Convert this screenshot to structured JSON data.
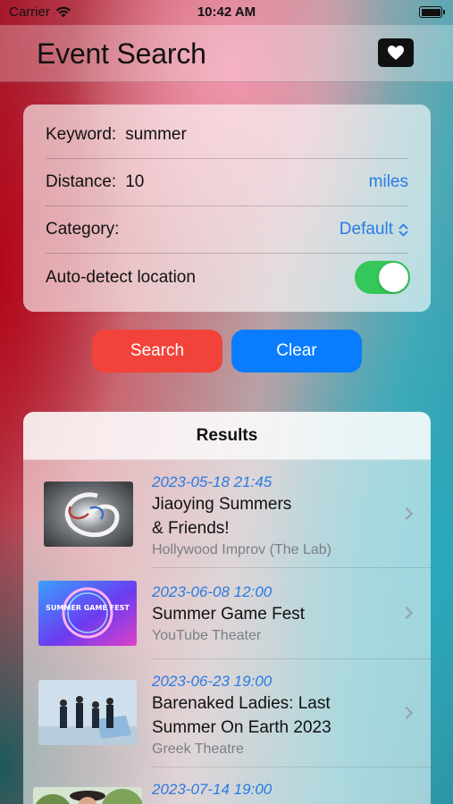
{
  "status_bar": {
    "carrier": "Carrier",
    "time": "10:42 AM",
    "battery_level": 1.0
  },
  "nav": {
    "title": "Event Search",
    "favorites_icon": "heart-icon"
  },
  "form": {
    "keyword_label": "Keyword:",
    "keyword_value": "summer",
    "distance_label": "Distance:",
    "distance_value": "10",
    "distance_unit": "miles",
    "category_label": "Category:",
    "category_value": "Default",
    "autodetect_label": "Auto-detect location",
    "autodetect_on": true
  },
  "buttons": {
    "search_label": "Search",
    "clear_label": "Clear"
  },
  "results": {
    "header": "Results",
    "items": [
      {
        "date": "2023-05-18 21:45",
        "name_line1": "Jiaoying Summers",
        "name_line2": "& Friends!",
        "venue": "Hollywood Improv (The Lab)"
      },
      {
        "date": "2023-06-08 12:00",
        "name_line1": "Summer Game Fest",
        "venue": "YouTube Theater",
        "thumb_text": "SUMMER GAME FEST"
      },
      {
        "date": "2023-06-23 19:00",
        "name_line1": "Barenaked Ladies: Last",
        "name_line2": "Summer On Earth 2023",
        "venue": "Greek Theatre"
      },
      {
        "date": "2023-07-14 19:00"
      }
    ]
  },
  "colors": {
    "accent_blue": "#2a7be4",
    "search_red": "#f2433a",
    "clear_blue": "#0a7cff",
    "toggle_green": "#34c759"
  }
}
